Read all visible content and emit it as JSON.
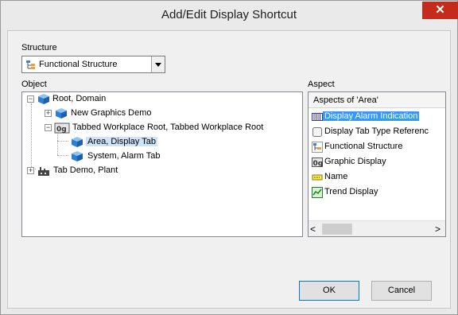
{
  "window": {
    "title": "Add/Edit Display Shortcut",
    "close_glyph": "✕"
  },
  "structure": {
    "label": "Structure",
    "selected": "Functional Structure",
    "icon": "functional-structure-icon"
  },
  "object": {
    "label": "Object",
    "nodes": [
      {
        "label": "Root, Domain",
        "icon": "cube-icon"
      },
      {
        "label": "New Graphics Demo",
        "icon": "cube-icon"
      },
      {
        "label": "Tabbed Workplace Root, Tabbed Workplace Root",
        "icon": "workplace-icon"
      },
      {
        "label": "Area, Display Tab",
        "icon": "cube-icon"
      },
      {
        "label": "System, Alarm Tab",
        "icon": "cube-icon"
      },
      {
        "label": "Tab Demo, Plant",
        "icon": "plant-icon"
      }
    ]
  },
  "aspect": {
    "label": "Aspect",
    "header": "Aspects of 'Area'",
    "items": [
      {
        "label": "Display Alarm Indication",
        "icon": "alarm-grid-icon"
      },
      {
        "label": "Display Tab Type Referenc",
        "icon": "tab-type-icon"
      },
      {
        "label": "Functional Structure",
        "icon": "functional-structure-icon"
      },
      {
        "label": "Graphic Display",
        "icon": "graphic-display-icon"
      },
      {
        "label": "Name",
        "icon": "name-tag-icon"
      },
      {
        "label": "Trend Display",
        "icon": "trend-chart-icon"
      }
    ],
    "scroll_left": "<",
    "scroll_right": ">"
  },
  "buttons": {
    "ok": "OK",
    "cancel": "Cancel"
  },
  "colors": {
    "selection": "#3399ff",
    "close": "#c42b1c"
  }
}
